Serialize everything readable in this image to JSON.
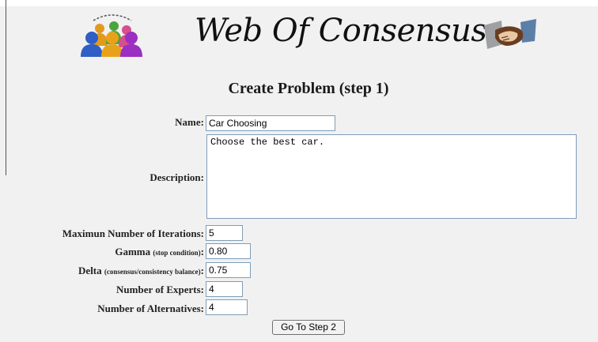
{
  "header": {
    "site_title": "Web Of Consensus",
    "people_logo": "people-group-icon",
    "handshake_logo": "handshake-icon"
  },
  "page_heading": "Create Problem (step 1)",
  "form": {
    "name_label": "Name:",
    "name_value": "Car Choosing",
    "description_label": "Description:",
    "description_value": "Choose the best car.",
    "max_iterations_label": "Maximun Number of Iterations:",
    "max_iterations_value": "5",
    "gamma_label": "Gamma",
    "gamma_note": "(stop condition)",
    "gamma_colon": ":",
    "gamma_value": "0.80",
    "delta_label": "Delta",
    "delta_note": "(consensus/consistency balance)",
    "delta_colon": ":",
    "delta_value": "0.75",
    "experts_label": "Number of Experts:",
    "experts_value": "4",
    "alternatives_label": "Number of Alternatives:",
    "alternatives_value": "4",
    "submit_label": "Go To Step 2"
  },
  "colors": {
    "background": "#f1f1f1",
    "field_border": "#7f9db9"
  }
}
